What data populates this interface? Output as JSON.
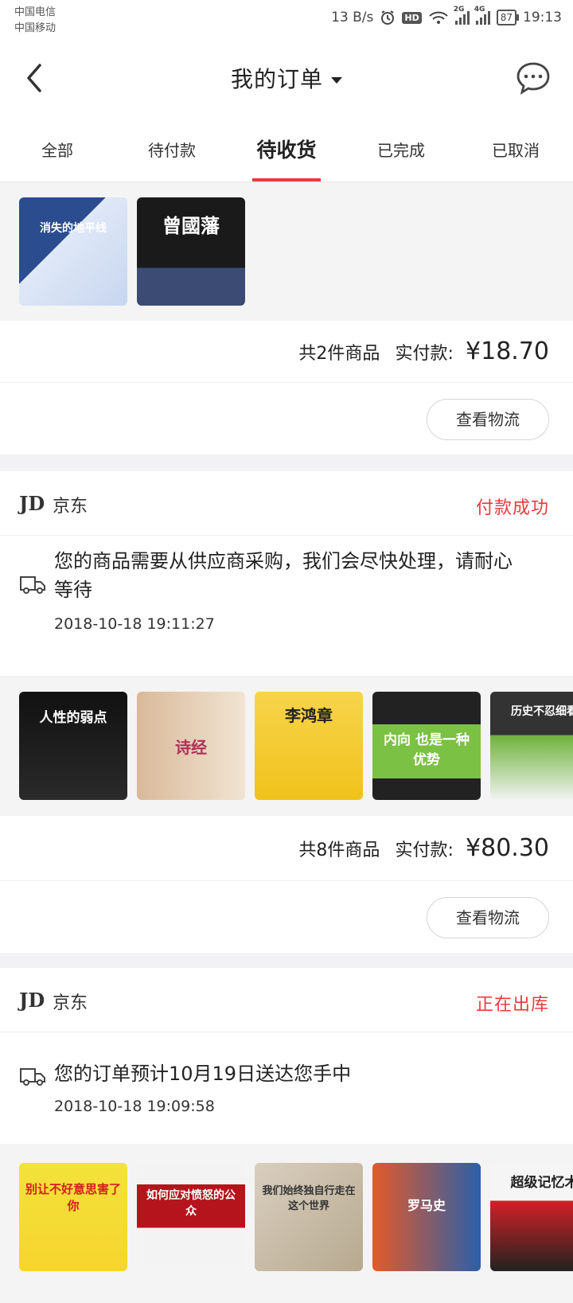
{
  "status_bar": {
    "carrier1": "中国电信",
    "carrier2": "中国移动",
    "speed": "13 B/s",
    "hd": "HD",
    "net1": "2G",
    "net2": "4G",
    "battery": "87",
    "time": "19:13"
  },
  "header": {
    "title": "我的订单"
  },
  "tabs": [
    {
      "label": "全部"
    },
    {
      "label": "待付款"
    },
    {
      "label": "待收货"
    },
    {
      "label": "已完成"
    },
    {
      "label": "已取消"
    }
  ],
  "orders": [
    {
      "books": [
        {
          "title": "消失的地平线",
          "colors": [
            "#2b4c8f",
            "#dfe8f7"
          ]
        },
        {
          "title": "曾國藩",
          "colors": [
            "#1a1a1a",
            "#3b4b73"
          ]
        }
      ],
      "count_text": "共2件商品",
      "paid_label": "实付款:",
      "price": "¥18.70",
      "logistics_button": "查看物流"
    },
    {
      "shop_logo": "JD",
      "shop_name": "京东",
      "status": "付款成功",
      "message": "您的商品需要从供应商采购，我们会尽快处理，请耐心等待",
      "time": "2018-10-18  19:11:27",
      "books": [
        {
          "title": "人性的弱点",
          "colors": [
            "#111111",
            "#2a2a2a"
          ]
        },
        {
          "title": "诗经",
          "colors": [
            "#d9b99a",
            "#f1e4d2"
          ]
        },
        {
          "title": "李鸿章",
          "colors": [
            "#f0c21b",
            "#f7d44a"
          ]
        },
        {
          "title": "内向 也是一种 优势",
          "colors": [
            "#222222",
            "#7bc143"
          ]
        },
        {
          "title": "历史不忍细看",
          "colors": [
            "#333333",
            "#6fb23a"
          ]
        }
      ],
      "count_text": "共8件商品",
      "paid_label": "实付款:",
      "price": "¥80.30",
      "logistics_button": "查看物流"
    },
    {
      "shop_logo": "JD",
      "shop_name": "京东",
      "status": "正在出库",
      "message": "您的订单预计10月19日送达您手中",
      "time": "2018-10-18  19:09:58",
      "books": [
        {
          "title": "别让不好意思害了你",
          "colors": [
            "#f3e23a",
            "#f6d52e"
          ]
        },
        {
          "title": "如何应对愤怒的公众",
          "colors": [
            "#b5141c",
            "#f3f3f3"
          ]
        },
        {
          "title": "我们始终独自行走在这个世界",
          "colors": [
            "#d9cfbf",
            "#b7a98f"
          ]
        },
        {
          "title": "罗马史",
          "colors": [
            "#e45a2a",
            "#2b5fa8"
          ]
        },
        {
          "title": "超级记忆术",
          "colors": [
            "#f5f5f5",
            "#d32027"
          ]
        }
      ]
    }
  ]
}
